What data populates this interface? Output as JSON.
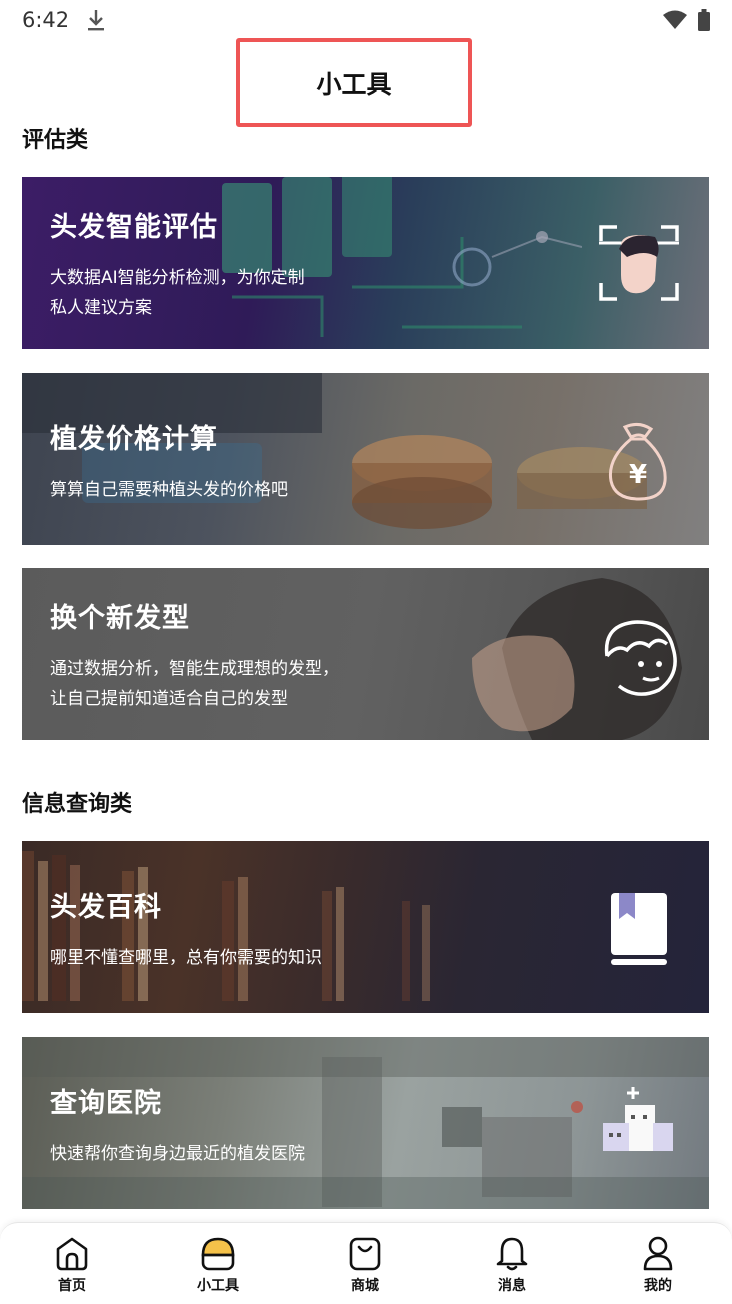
{
  "status_bar": {
    "time": "6:42"
  },
  "header": {
    "title": "小工具"
  },
  "sections": [
    {
      "title": "评估类"
    },
    {
      "title": "信息查询类"
    }
  ],
  "cards": [
    {
      "title": "头发智能评估",
      "desc": "大数据AI智能分析检测，为你定制\n私人建议方案",
      "icon": "face-scan-icon"
    },
    {
      "title": "植发价格计算",
      "desc": "算算自己需要种植头发的价格吧",
      "icon": "money-bag-icon"
    },
    {
      "title": "换个新发型",
      "desc": "通过数据分析，智能生成理想的发型，\n让自己提前知道适合自己的发型",
      "icon": "hair-face-icon"
    },
    {
      "title": "头发百科",
      "desc": "哪里不懂查哪里，总有你需要的知识",
      "icon": "book-icon"
    },
    {
      "title": "查询医院",
      "desc": "快速帮你查询身边最近的植发医院",
      "icon": "hospital-icon"
    }
  ],
  "tabbar": {
    "items": [
      {
        "label": "首页",
        "icon": "home-icon"
      },
      {
        "label": "小工具",
        "icon": "tools-icon",
        "active": true
      },
      {
        "label": "商城",
        "icon": "shop-bag-icon"
      },
      {
        "label": "消息",
        "icon": "bell-icon"
      },
      {
        "label": "我的",
        "icon": "user-icon"
      }
    ],
    "accent": "#f5c24a"
  }
}
